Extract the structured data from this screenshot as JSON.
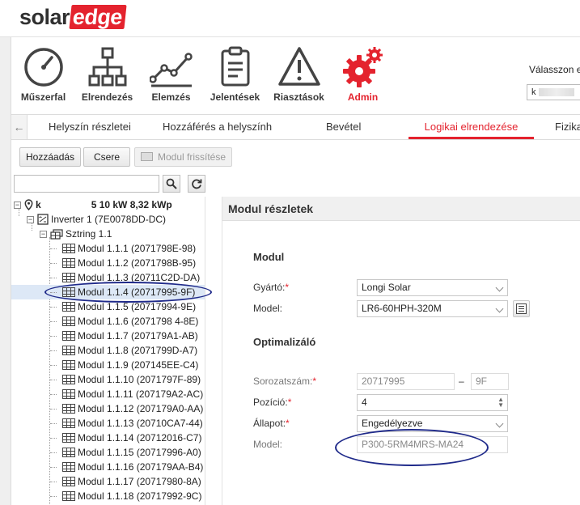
{
  "brand": {
    "part1": "solar",
    "part2": "edge",
    "accent": "#e4232e"
  },
  "main_nav": [
    {
      "label": "Műszerfal",
      "icon": "gauge-icon"
    },
    {
      "label": "Elrendezés",
      "icon": "layout-tree-icon"
    },
    {
      "label": "Elemzés",
      "icon": "line-graph-icon"
    },
    {
      "label": "Jelentések",
      "icon": "clipboard-icon"
    },
    {
      "label": "Riasztások",
      "icon": "warning-triangle-icon"
    },
    {
      "label": "Admin",
      "icon": "gears-icon"
    }
  ],
  "site_select": {
    "prompt": "Válasszon e",
    "value_prefix": "k"
  },
  "tabs": [
    {
      "label": "Helyszín részletei"
    },
    {
      "label": "Hozzáférés a helyszính"
    },
    {
      "label": "Bevétel"
    },
    {
      "label": "Logikai elrendezése",
      "active": true
    },
    {
      "label": "Fizika"
    }
  ],
  "toolbar": {
    "add": "Hozzáadás",
    "replace": "Csere",
    "refresh_module": "Modul frissítése"
  },
  "tree": {
    "site": {
      "prefix": "k",
      "suffix": "5 10 kW 8,32 kWp"
    },
    "inverter": "Inverter 1 (7E0078DD-DC)",
    "string": "Sztring 1.1",
    "modules": [
      "Modul 1.1.1 (2071798E-98)",
      "Modul 1.1.2 (2071798B-95)",
      "Modul 1.1.3 (20711C2D-DA)",
      "Modul 1.1.4 (20717995-9F)",
      "Modul 1.1.5 (20717994-9E)",
      "Modul 1.1.6 (2071798 4-8E)",
      "Modul 1.1.7 (207179A1-AB)",
      "Modul 1.1.8 (2071799D-A7)",
      "Modul 1.1.9 (207145EE-C4)",
      "Modul 1.1.10 (2071797F-89)",
      "Modul 1.1.11 (207179A2-AC)",
      "Modul 1.1.12 (207179A0-AA)",
      "Modul 1.1.13 (20710CA7-44)",
      "Modul 1.1.14 (20712016-C7)",
      "Modul 1.1.15 (20717996-A0)",
      "Modul 1.1.16 (207179AA-B4)",
      "Modul 1.1.17 (20717980-8A)",
      "Modul 1.1.18 (20717992-9C)"
    ]
  },
  "details": {
    "title": "Modul részletek",
    "module_section": "Modul",
    "manufacturer_label": "Gyártó:",
    "manufacturer_value": "Longi Solar",
    "model_label": "Model:",
    "model_value": "LR6-60HPH-320M",
    "optimizer_section": "Optimalizáló",
    "serial_label": "Sorozatszám:",
    "serial_part1": "20717995",
    "serial_sep": "–",
    "serial_part2": "9F",
    "position_label": "Pozíció:",
    "position_value": "4",
    "status_label": "Állapot:",
    "status_value": "Engedélyezve",
    "opt_model_label": "Model:",
    "opt_model_value": "P300-5RM4MRS-MA24",
    "required_mark": "*"
  }
}
